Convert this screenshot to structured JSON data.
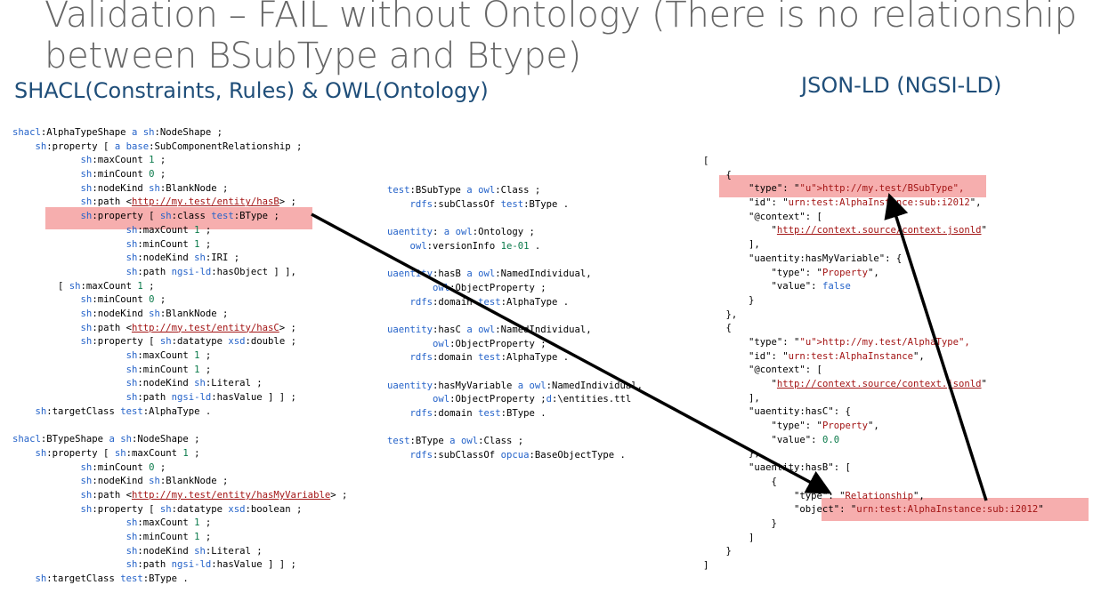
{
  "title": "Validation – FAIL without Ontology (There is no relationship between BSubType and Btype)",
  "subheads": {
    "left": "SHACL(Constraints, Rules)  &  OWL(Ontology)",
    "right": "JSON-LD (NGSI-LD)"
  },
  "colors": {
    "keyword": "#2563c9",
    "number": "#0a7a4a",
    "string": "#a31515",
    "highlight": "#f4a0a0",
    "heading": "#1f4e79",
    "title": "#666666"
  },
  "shacl_lines": [
    "shacl:AlphaTypeShape a sh:NodeShape ;",
    "    sh:property [ a base:SubComponentRelationship ;",
    "            sh:maxCount 1 ;",
    "            sh:minCount 0 ;",
    "            sh:nodeKind sh:BlankNode ;",
    "            sh:path <http://my.test/entity/hasB> ;",
    "            sh:property [ sh:class test:BType ;",
    "                    sh:maxCount 1 ;",
    "                    sh:minCount 1 ;",
    "                    sh:nodeKind sh:IRI ;",
    "                    sh:path ngsi-ld:hasObject ] ],",
    "        [ sh:maxCount 1 ;",
    "            sh:minCount 0 ;",
    "            sh:nodeKind sh:BlankNode ;",
    "            sh:path <http://my.test/entity/hasC> ;",
    "            sh:property [ sh:datatype xsd:double ;",
    "                    sh:maxCount 1 ;",
    "                    sh:minCount 1 ;",
    "                    sh:nodeKind sh:Literal ;",
    "                    sh:path ngsi-ld:hasValue ] ] ;",
    "    sh:targetClass test:AlphaType .",
    "",
    "shacl:BTypeShape a sh:NodeShape ;",
    "    sh:property [ sh:maxCount 1 ;",
    "            sh:minCount 0 ;",
    "            sh:nodeKind sh:BlankNode ;",
    "            sh:path <http://my.test/entity/hasMyVariable> ;",
    "            sh:property [ sh:datatype xsd:boolean ;",
    "                    sh:maxCount 1 ;",
    "                    sh:minCount 1 ;",
    "                    sh:nodeKind sh:Literal ;",
    "                    sh:path ngsi-ld:hasValue ] ] ;",
    "    sh:targetClass test:BType ."
  ],
  "owl_lines": [
    "test:BSubType a owl:Class ;",
    "    rdfs:subClassOf test:BType .",
    "",
    "uaentity: a owl:Ontology ;",
    "    owl:versionInfo 1e-01 .",
    "",
    "uaentity:hasB a owl:NamedIndividual,",
    "        owl:ObjectProperty ;",
    "    rdfs:domain test:AlphaType .",
    "",
    "uaentity:hasC a owl:NamedIndividual,",
    "        owl:ObjectProperty ;",
    "    rdfs:domain test:AlphaType .",
    "",
    "uaentity:hasMyVariable a owl:NamedIndividual,",
    "        owl:ObjectProperty ;d:\\entities.ttl",
    "    rdfs:domain test:BType .",
    "",
    "test:BType a owl:Class ;",
    "    rdfs:subClassOf opcua:BaseObjectType ."
  ],
  "json_lines": [
    "[",
    "    {",
    "        \"type\": \"http://my.test/BSubType\",",
    "        \"id\": \"urn:test:AlphaInstance:sub:i2012\",",
    "        \"@context\": [",
    "            \"http://context.source/context.jsonld\"",
    "        ],",
    "        \"uaentity:hasMyVariable\": {",
    "            \"type\": \"Property\",",
    "            \"value\": false",
    "        }",
    "    },",
    "    {",
    "        \"type\": \"http://my.test/AlphaType\",",
    "        \"id\": \"urn:test:AlphaInstance\",",
    "        \"@context\": [",
    "            \"http://context.source/context.jsonld\"",
    "        ],",
    "        \"uaentity:hasC\": {",
    "            \"type\": \"Property\",",
    "            \"value\": 0.0",
    "        },",
    "        \"uaentity:hasB\": [",
    "            {",
    "                \"type\": \"Relationship\",",
    "                \"object\": \"urn:test:AlphaInstance:sub:i2012\"",
    "            }",
    "        ]",
    "    }",
    "]"
  ]
}
